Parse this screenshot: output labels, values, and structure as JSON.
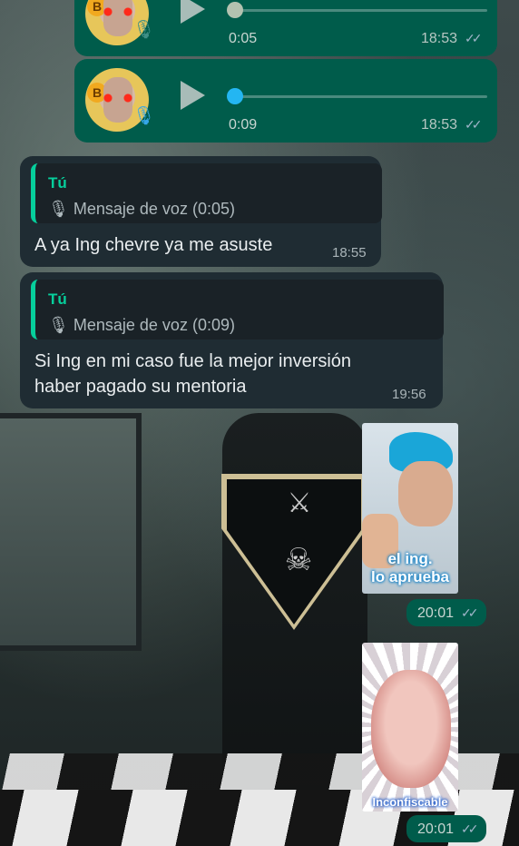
{
  "chat": {
    "voice_notes": [
      {
        "duration": "0:05",
        "time": "18:53",
        "status": "read",
        "played": true
      },
      {
        "duration": "0:09",
        "time": "18:53",
        "status": "read",
        "played": false
      }
    ],
    "replies": [
      {
        "quote_author": "Tú",
        "quote_text": "Mensaje de voz (0:05)",
        "text": "A ya Ing chevre ya me asuste",
        "time": "18:55"
      },
      {
        "quote_author": "Tú",
        "quote_text": "Mensaje de voz (0:09)",
        "text_line1": "Si Ing en mi caso fue la mejor inversión",
        "text_line2": "haber pagado su mentoria",
        "time": "19:56"
      }
    ],
    "stickers": [
      {
        "caption_line1": "el ing.",
        "caption_line2": "lo aprueba",
        "time": "20:01",
        "status": "read"
      },
      {
        "caption": "Inconfiscable",
        "time": "20:01",
        "status": "read"
      }
    ]
  },
  "icons": {
    "mic": "microphone-icon",
    "play": "play-icon",
    "read_ticks": "double-check-icon",
    "bitcoin": "bitcoin-coin-icon"
  },
  "colors": {
    "outgoing_bubble": "#005c4b",
    "incoming_bubble": "#1f2c33",
    "quote_accent": "#06cf9c",
    "unplayed_dot": "#24b6f2"
  }
}
